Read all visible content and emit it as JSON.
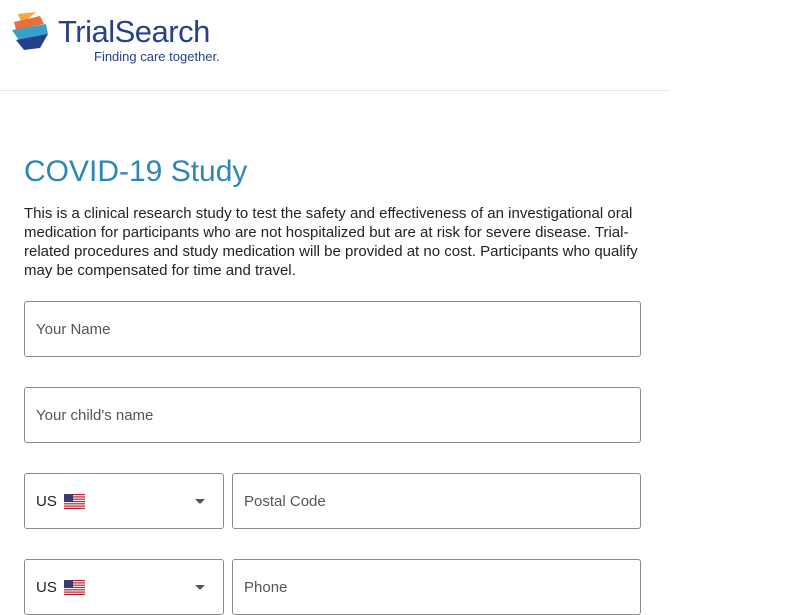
{
  "header": {
    "logo_wordmark": "TrialSearch",
    "logo_tagline": "Finding care together.",
    "logo_colors": [
      "#f4a93b",
      "#e8713a",
      "#3aa0c9",
      "#27408b"
    ]
  },
  "main": {
    "title": "COVID-19 Study",
    "description": "This is a clinical research study to test the safety and effectiveness of an investigational oral medication for participants who are not hospitalized but are at risk for severe disease. Trial-related procedures and study medication will be provided at no cost. Participants who qualify may be compensated for time and travel."
  },
  "form": {
    "name_placeholder": "Your Name",
    "child_name_placeholder": "Your child's name",
    "postal_country": {
      "code": "US",
      "flag_icon": "us-flag-icon"
    },
    "postal_placeholder": "Postal Code",
    "phone_country": {
      "code": "US",
      "flag_icon": "us-flag-icon"
    },
    "phone_placeholder": "Phone"
  },
  "colors": {
    "title": "#2c86b6",
    "brand": "#27408b",
    "field_border": "#8a8a8a"
  }
}
